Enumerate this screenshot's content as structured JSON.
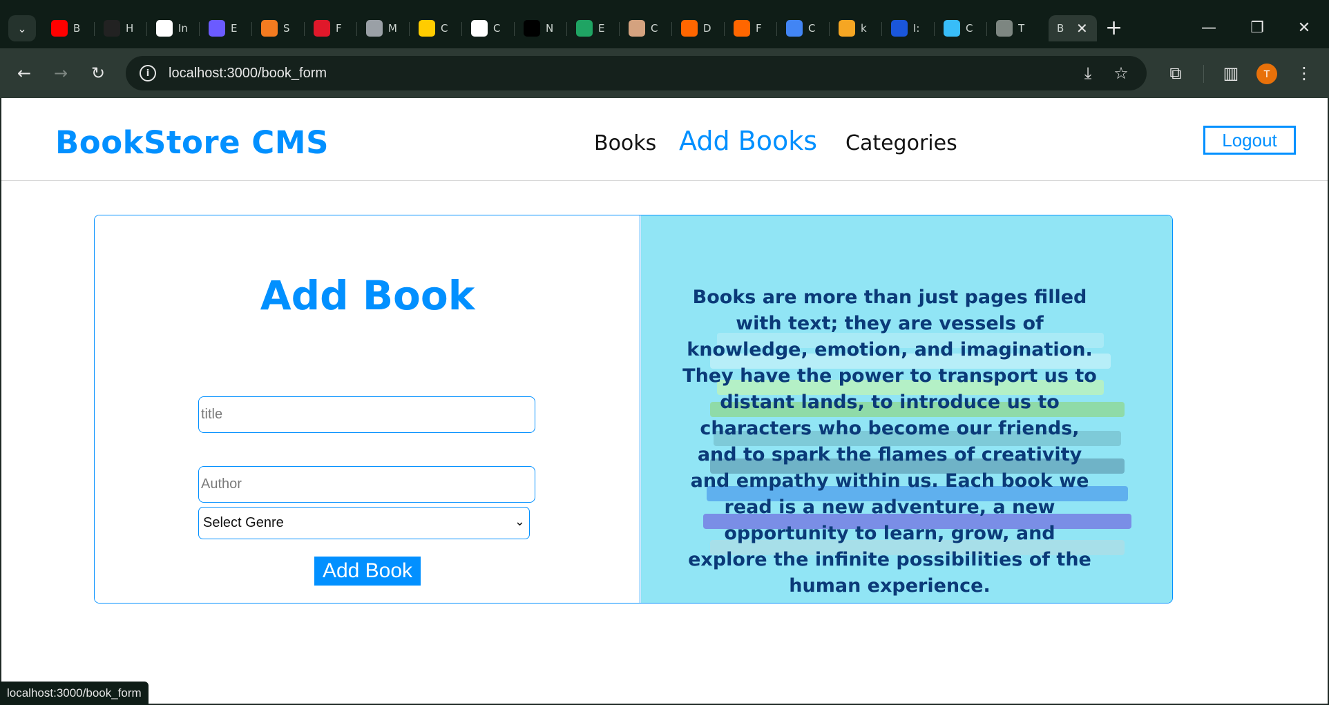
{
  "browser": {
    "tabs": [
      {
        "icon": "youtube-icon",
        "label": "B",
        "color": "#ff0000"
      },
      {
        "icon": "palette-icon",
        "label": "H",
        "color": "#222222"
      },
      {
        "icon": "dots-icon",
        "label": "In",
        "color": "#ffffff"
      },
      {
        "icon": "ui-icon",
        "label": "E",
        "color": "#6b5bff"
      },
      {
        "icon": "squares-icon",
        "label": "S",
        "color": "#f47b20"
      },
      {
        "icon": "d-icon",
        "label": "F",
        "color": "#e0182a"
      },
      {
        "icon": "globe-icon",
        "label": "M",
        "color": "#9aa0a6"
      },
      {
        "icon": "cup-icon",
        "label": "C",
        "color": "#ffcc00"
      },
      {
        "icon": "cc-icon",
        "label": "C",
        "color": "#ffffff"
      },
      {
        "icon": "triangle-icon",
        "label": "N",
        "color": "#000000"
      },
      {
        "icon": "drive-icon",
        "label": "E",
        "color": "#1fa463"
      },
      {
        "icon": "ai-icon",
        "label": "C",
        "color": "#d4a27f"
      },
      {
        "icon": "y-icon",
        "label": "D",
        "color": "#ff6600"
      },
      {
        "icon": "y-icon",
        "label": "F",
        "color": "#ff6600"
      },
      {
        "icon": "docs-icon",
        "label": "C",
        "color": "#4285f4"
      },
      {
        "icon": "cat-icon",
        "label": "k",
        "color": "#f5a623"
      },
      {
        "icon": "p-icon",
        "label": "I:",
        "color": "#1a56db"
      },
      {
        "icon": "wave-icon",
        "label": "C",
        "color": "#38bdf8"
      },
      {
        "icon": "thumb-icon",
        "label": "T",
        "color": "#7d8681"
      }
    ],
    "active_tab": {
      "label": "B",
      "close": "✕"
    },
    "new_tab": "+",
    "window_controls": {
      "minimize": "—",
      "restore": "❐",
      "close": "✕"
    },
    "nav": {
      "back": "←",
      "forward": "→",
      "reload": "↻"
    },
    "url_host": "localhost",
    "url_path": ":3000/book_form",
    "profile_initial": "T",
    "status_url": "localhost:3000/book_form"
  },
  "site": {
    "brand": "BookStore CMS",
    "nav": {
      "books": "Books",
      "add_books": "Add Books",
      "categories": "Categories"
    },
    "logout": "Logout"
  },
  "form": {
    "title": "Add Book",
    "title_placeholder": "title",
    "author_placeholder": "Author",
    "genre_selected": "Select Genre",
    "submit": "Add Book"
  },
  "quote": {
    "text": "Books are more than just pages filled with text; they are vessels of knowledge, emotion, and imagination. They have the power to transport us to distant lands, to introduce us to characters who become our friends, and to spark the flames of creativity and empathy within us. Each book we read is a new adventure, a new opportunity to learn, grow, and explore the infinite possibilities of the human experience."
  },
  "colors": {
    "accent": "#0290ff",
    "quote_panel": "#91e5f5",
    "quote_text": "#0b3a78"
  }
}
